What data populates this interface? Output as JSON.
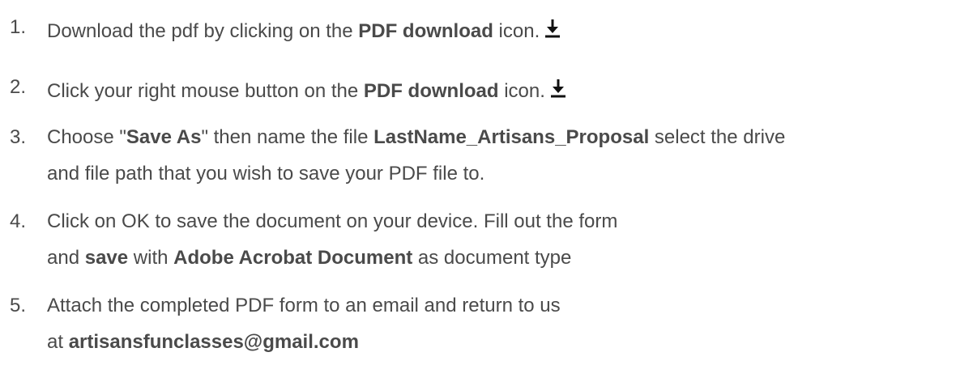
{
  "steps": [
    {
      "number": "1.",
      "t1": "Download the pdf by clicking on the ",
      "b1": "PDF download",
      "t2": " icon.",
      "icon": "download-icon"
    },
    {
      "number": "2.",
      "t1": "Click your right mouse button on the ",
      "b1": "PDF download",
      "t2": " icon.",
      "icon": "download-icon"
    },
    {
      "number": "3.",
      "t1": "Choose \"",
      "b1": "Save As",
      "t2": "\" then name the file ",
      "b2": "LastName_Artisans_Proposal",
      "t3": " select the drive",
      "line2": "and file path that you wish to save your PDF file to."
    },
    {
      "number": "4.",
      "t1": "Click on OK to save the document on your device.  Fill out the form",
      "l2_t1": "and ",
      "l2_b1": "save",
      "l2_t2": " with ",
      "l2_b2": "Adobe Acrobat Document",
      "l2_t3": " as document type"
    },
    {
      "number": "5.",
      "t1": "Attach the completed PDF form to an email and return to us",
      "l2_t1": "at ",
      "l2_b1": "artisansfunclasses@gmail.com"
    }
  ]
}
